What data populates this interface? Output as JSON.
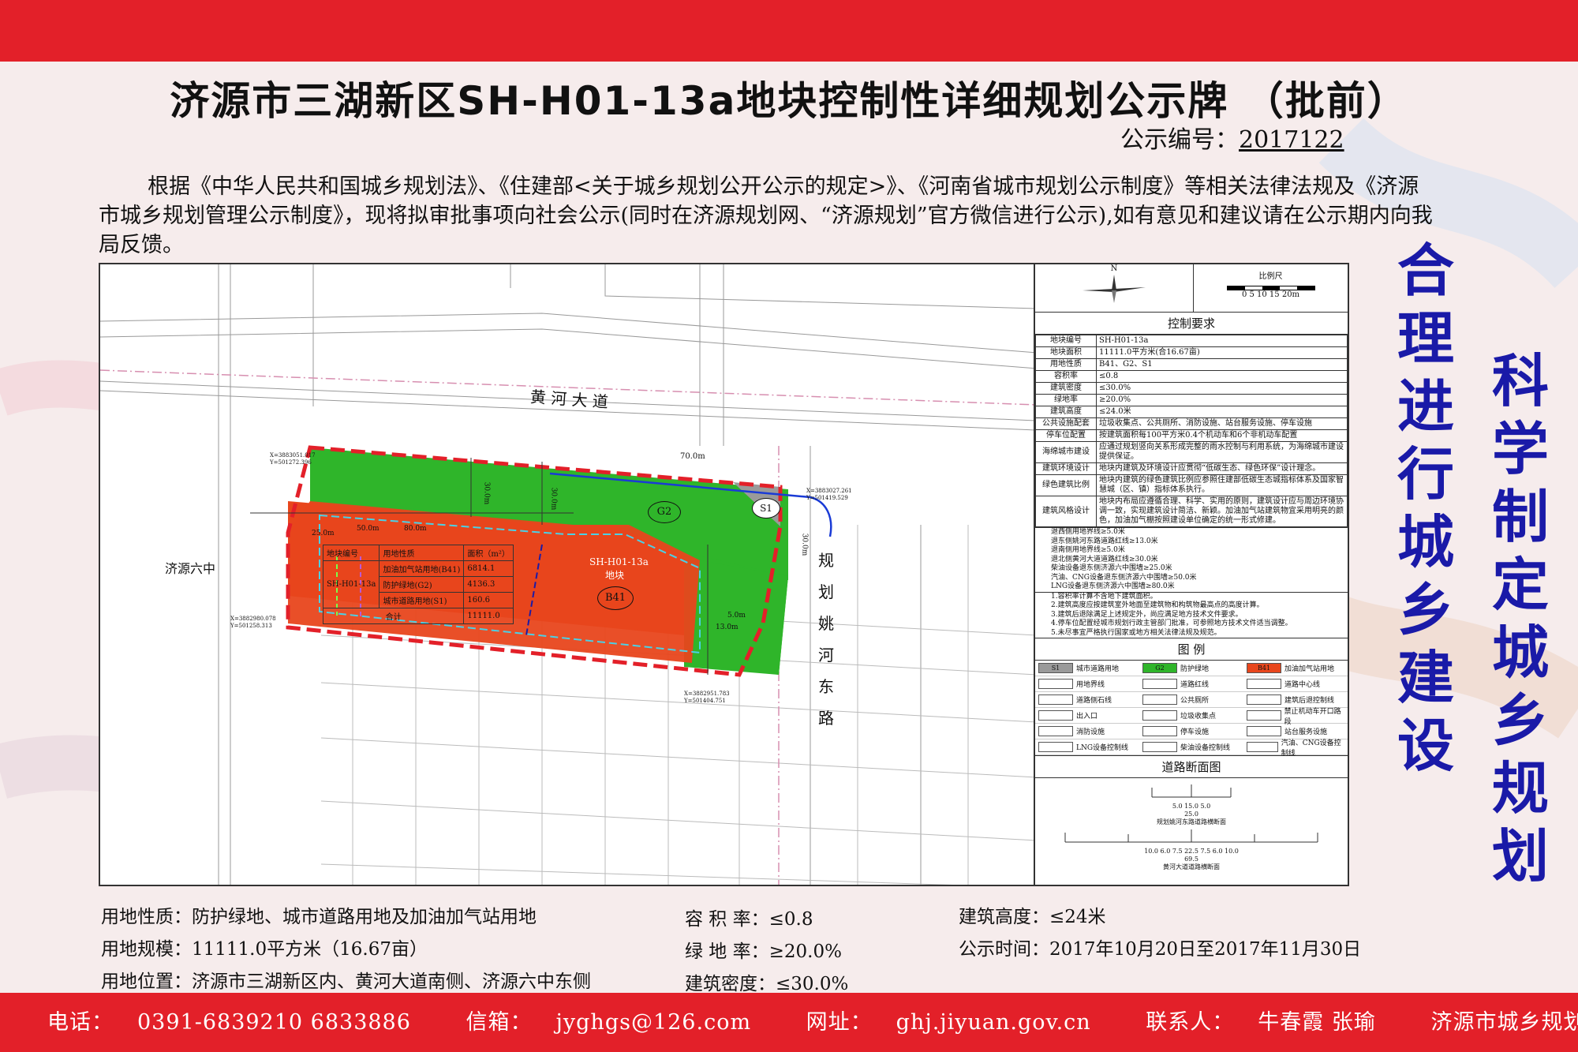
{
  "title": "济源市三湖新区SH-H01-13a地块控制性详细规划公示牌 （批前）",
  "notice_no": {
    "label": "公示编号：",
    "value": "2017122"
  },
  "intro": "根据《中华人民共和国城乡规划法》、《住建部<关于城乡规划公开公示的规定>》、《河南省城市规划公示制度》等相关法律法规及《济源市城乡规划管理公示制度》，现将拟审批事项向社会公示(同时在济源规划网、“济源规划”官方微信进行公示),如有意见和建议请在公示期内向我局反馈。",
  "slogans": {
    "left": "合理进行城乡建设",
    "right": "科学制定城乡规划"
  },
  "map": {
    "road_north": "黄 河 大 道",
    "road_east": "规 划 姚 河 东 路",
    "school": "济源六中",
    "parcel_name": "SH-H01-13a",
    "parcel_sub": "地块",
    "badge_b41": "B41",
    "badge_g2": "G2",
    "badge_s1": "S1",
    "dim_70": "70.0m",
    "dim_30a": "30.0m",
    "dim_30b": "30.0m",
    "dim_25": "25.0m",
    "dim_50": "50.0m",
    "dim_80": "80.0m",
    "dim_13": "13.0m",
    "dim_5": "5.0m",
    "coord1": "X=3883051.017",
    "coord1y": "Y=501272.396",
    "coord2": "X=3883027.261",
    "coord2y": "Y=501419.529",
    "coord3": "X=3882980.078",
    "coord3y": "Y=501258.313",
    "coord4": "X=3882951.783",
    "coord4y": "Y=501404.751",
    "site_table": {
      "headers": [
        "地块编号",
        "用地性质",
        "面积（m²）"
      ],
      "code": "SH-H01-13a",
      "rows": [
        [
          "加油加气站用地(B41)",
          "6814.1"
        ],
        [
          "防护绿地(G2)",
          "4136.3"
        ],
        [
          "城市道路用地(S1)",
          "160.6"
        ]
      ],
      "total_label": "合计",
      "total": "11111.0"
    }
  },
  "panel": {
    "north": "N",
    "scale_title": "比例尺",
    "scale_ticks": "0  5  10  15  20m",
    "control_title": "控制要求",
    "rows": [
      [
        "地块编号",
        "SH-H01-13a"
      ],
      [
        "地块面积",
        "11111.0平方米(合16.67亩)"
      ],
      [
        "用地性质",
        "B41、G2、S1"
      ],
      [
        "容积率",
        "≤0.8"
      ],
      [
        "建筑密度",
        "≤30.0%"
      ],
      [
        "绿地率",
        "≥20.0%"
      ],
      [
        "建筑高度",
        "≤24.0米"
      ],
      [
        "公共设施配套",
        "垃圾收集点、公共厕所、消防设施、站台服务设施、停车设施"
      ],
      [
        "停车位配置",
        "按建筑面积每100平方米0.4个机动车和6个非机动车配置"
      ],
      [
        "海绵城市建设",
        "应通过规划竖向关系形成完整的雨水控制与利用系统，为海绵城市建设提供保证。"
      ],
      [
        "建筑环境设计",
        "地块内建筑及环境设计应贯彻“低碳生态、绿色环保”设计理念。"
      ],
      [
        "绿色建筑比例",
        "地块内建筑的绿色建筑比例应参照住建部低碳生态城指标体系及国家智慧城（区、镇）指标体系执行。"
      ],
      [
        "建筑风格设计",
        "地块内布局应遵循合理、科学、实用的原则，建筑设计应与周边环境协调一致，实现建筑设计简洁、新颖。加油加气站建筑物宜采用明亮的颜色，加油加气棚按照建设单位确定的统一形式修建。"
      ]
    ],
    "setbacks": [
      "退西侧用地界线≥5.0米",
      "退东侧姚河东路道路红线≥13.0米",
      "退南侧用地界线≥5.0米",
      "退北侧黄河大道道路红线≥30.0米",
      "柴油设备退东侧济源六中围墙≥25.0米",
      "汽油、CNG设备退东侧济源六中围墙≥50.0米",
      "LNG设备退东侧济源六中围墙≥80.0米"
    ],
    "notes": [
      "1.容积率计算不含地下建筑面积。",
      "2.建筑高度应按建筑室外地面至建筑物和构筑物最高点的高度计算。",
      "3.建筑后退除满足上述规定外，尚应满足地方技术文件要求。",
      "4.停车位配置经城市规划行政主管部门批准，可参照地方技术文件适当调整。",
      "5.未尽事宜严格执行国家或地方相关法律法规及规范。"
    ],
    "legend_title": "图  例",
    "legend": [
      [
        "S1",
        "城市道路用地"
      ],
      [
        "G2",
        "防护绿地"
      ],
      [
        "B41",
        "加油加气站用地"
      ],
      [
        "",
        "用地界线"
      ],
      [
        "",
        "道路红线"
      ],
      [
        "",
        "道路中心线"
      ],
      [
        "",
        "道路侧石线"
      ],
      [
        "",
        "公共厕所"
      ],
      [
        "",
        "建筑后退控制线"
      ],
      [
        "",
        "出入口"
      ],
      [
        "",
        "垃圾收集点"
      ],
      [
        "",
        "禁止机动车开口路段"
      ],
      [
        "",
        "消防设施"
      ],
      [
        "",
        "停车设施"
      ],
      [
        "",
        "站台服务设施"
      ],
      [
        "",
        "LNG设备控制线"
      ],
      [
        "",
        "柴油设备控制线"
      ],
      [
        "",
        "汽油、CNG设备控制线"
      ]
    ],
    "section_title": "道路断面图",
    "section1": {
      "dims": "5.0   15.0   5.0",
      "total": "25.0",
      "name": "规划姚河东路道路横断面"
    },
    "section2": {
      "dims": "10.0  6.0  7.5   22.5   7.5  6.0  10.0",
      "total": "69.5",
      "name": "黄河大道道路横断面"
    }
  },
  "summary": {
    "nature_label": "用地性质：",
    "nature": "防护绿地、城市道路用地及加油加气站用地",
    "scale_label": "用地规模：",
    "scale": "11111.0平方米（16.67亩）",
    "location_label": "用地位置：",
    "location": "济源市三湖新区内、黄河大道南侧、济源六中东侧",
    "far_label": "容 积 率：",
    "far": "≤0.8",
    "green_label": "绿 地 率：",
    "green": "≥20.0%",
    "density_label": "建筑密度：",
    "density": "≤30.0%",
    "height_label": "建筑高度：",
    "height": "≤24米",
    "period_label": "公示时间：",
    "period": "2017年10月20日至2017年11月30日"
  },
  "footer": {
    "phone_label": "电话：",
    "phone": "0391-6839210 6833886",
    "mail_label": "信箱：",
    "mail": "jyghgs@126.com",
    "web_label": "网址：",
    "web": "ghj.jiyuan.gov.cn",
    "contact_label": "联系人：",
    "contact": "牛春霞 张瑜",
    "supervisor": "济源市城乡规划局监制"
  },
  "colors": {
    "red": "#e32029",
    "green": "#2fb52a",
    "orange": "#e8461c",
    "blue": "#1a1aa8"
  }
}
